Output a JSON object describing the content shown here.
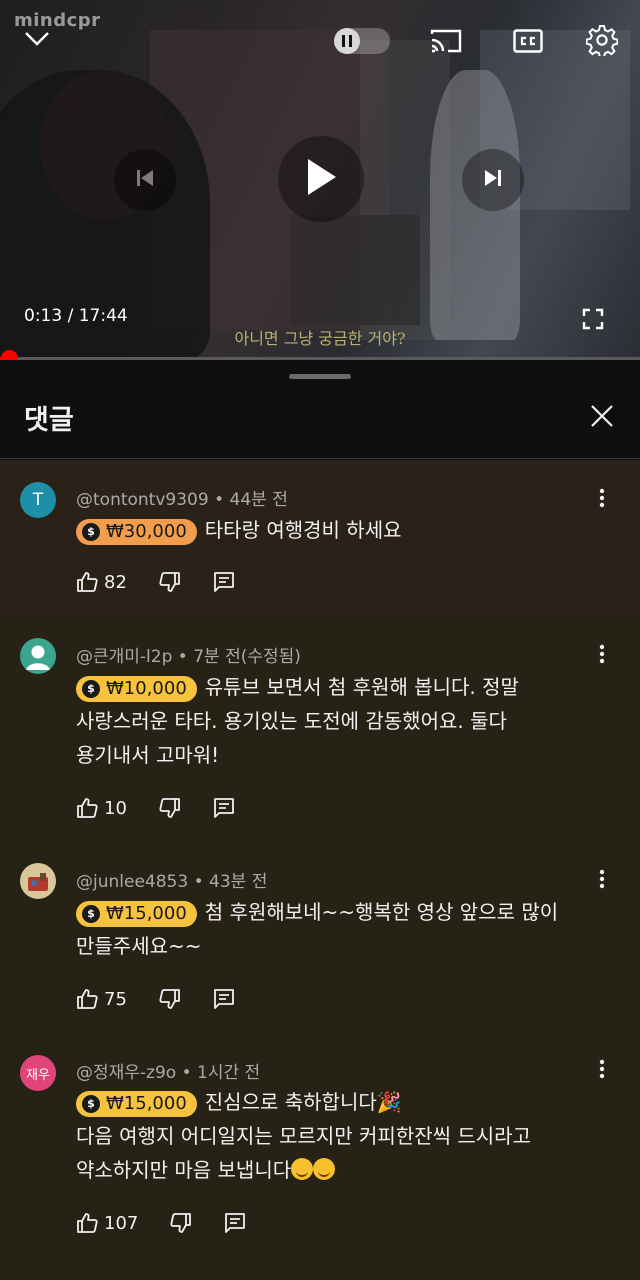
{
  "player": {
    "watermark": "mindcpr",
    "time_current": "0:13",
    "time_total": "17:44",
    "time_separator": " / ",
    "subtitle": "아니면 그냥 궁금한 거야?",
    "progress": 0.014,
    "icons": [
      "chevron-down-icon",
      "pause-icon",
      "cast-icon",
      "cc-icon",
      "settings-icon",
      "previous-icon",
      "play-icon",
      "next-icon",
      "fullscreen-icon"
    ]
  },
  "comments_panel": {
    "title": "댓글",
    "close_icon": "close-icon",
    "comments": [
      {
        "avatar_text": "T",
        "avatar_color": "#1e8fa6",
        "author": "@tontontv9309",
        "time": "44분 전",
        "chip_amount": "₩30,000",
        "chip_color": "#f29d4b",
        "lines": [
          "타타랑 여행경비 하세요"
        ],
        "likes": "82"
      },
      {
        "avatar_text": "",
        "avatar_color": "#3aa690",
        "author": "@큰개미-l2p",
        "time": "7분 전(수정됨)",
        "chip_amount": "₩10,000",
        "chip_color": "#f7c33f",
        "lines": [
          "유튜브 보면서 첨 후원해 봅니다. 정말",
          "사랑스러운 타타. 용기있는 도전에 감동했어요.  둘다",
          "용기내서 고마워!"
        ],
        "likes": "10"
      },
      {
        "avatar_text": "",
        "avatar_color": "#d9c79a",
        "author": "@junlee4853",
        "time": "43분 전",
        "chip_amount": "₩15,000",
        "chip_color": "#f7c33f",
        "lines": [
          "첨 후원해보네~~행복한 영상 앞으로 많이",
          "만들주세요~~"
        ],
        "likes": "75"
      },
      {
        "avatar_text": "재우",
        "avatar_color": "#e0457a",
        "author": "@정재우-z9o",
        "time": "1시간 전",
        "chip_amount": "₩15,000",
        "chip_color": "#f7c33f",
        "lines": [
          "진심으로 축하합니다🎉",
          "다음 여행지 어디일지는 모르지만 커피한잔씩 드시라고",
          "약소하지만 마음 보냅니다"
        ],
        "likes": "107"
      }
    ]
  }
}
